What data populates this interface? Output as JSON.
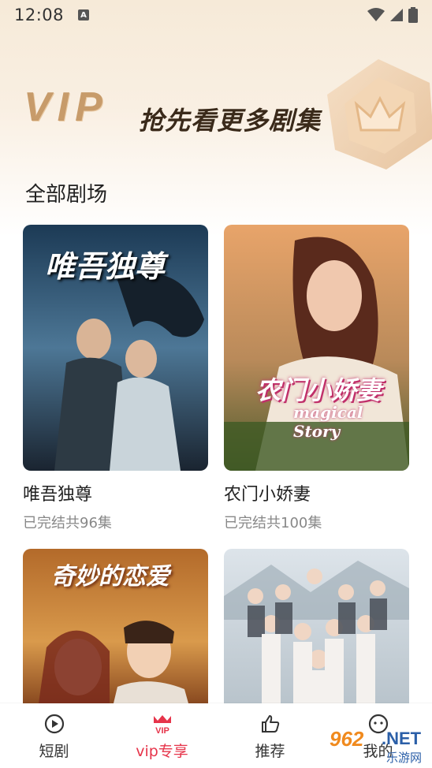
{
  "status_bar": {
    "time": "12:08",
    "sim_label": "A"
  },
  "banner": {
    "vip": "VIP",
    "slogan": "抢先看更多剧集"
  },
  "section": {
    "title": "全部剧场"
  },
  "dramas": [
    {
      "name": "唯吾独尊",
      "status": "已完结共96集",
      "poster_title": "唯吾独尊"
    },
    {
      "name": "农门小娇妻",
      "status": "已完结共100集",
      "poster_title": "农门小娇妻",
      "poster_subtitle": "magical Story"
    },
    {
      "name": "",
      "status": "",
      "poster_title": "奇妙的恋爱"
    },
    {
      "name": "",
      "status": "",
      "poster_title": ""
    }
  ],
  "tabs": [
    {
      "label": "短剧",
      "icon": "play-circle-icon",
      "active": false
    },
    {
      "label": "vip专享",
      "icon": "vip-crown-icon",
      "active": true
    },
    {
      "label": "推荐",
      "icon": "thumbs-up-icon",
      "active": false
    },
    {
      "label": "我的",
      "icon": "smiley-chat-icon",
      "active": false
    }
  ],
  "watermark": {
    "number": "962",
    "net": ".NET",
    "cn": "乐游网"
  },
  "colors": {
    "accent": "#e6344a",
    "gold": "#c79b6a"
  }
}
